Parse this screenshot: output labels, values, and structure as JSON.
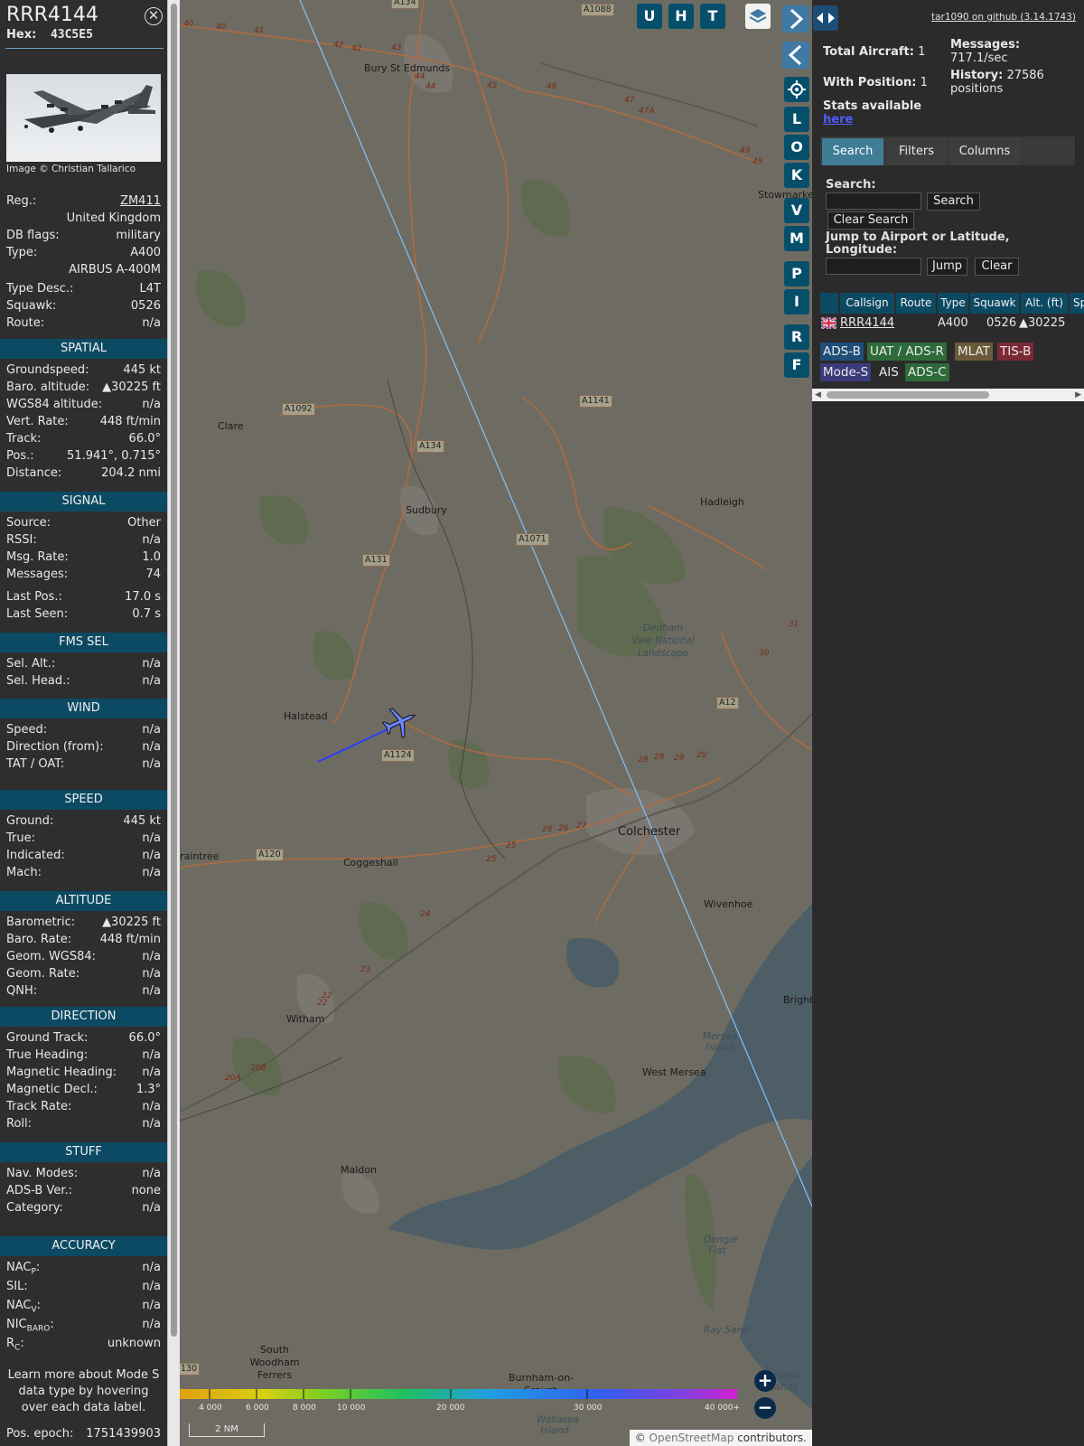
{
  "aircraft": {
    "callsign": "RRR4144",
    "hex_label": "Hex:",
    "hex": "43C5E5",
    "image_credit": "Image © Christian Tallarico",
    "fields": [
      {
        "k": "Reg.:",
        "v": "ZM411",
        "link": true
      },
      {
        "k": "",
        "v": "United Kingdom"
      },
      {
        "k": "DB flags:",
        "v": "military"
      },
      {
        "k": "Type:",
        "v": "A400"
      },
      {
        "k": "",
        "v": "AIRBUS A-400M"
      },
      {
        "k": "Type Desc.:",
        "v": "L4T"
      },
      {
        "k": "Squawk:",
        "v": "0526"
      },
      {
        "k": "Route:",
        "v": "n/a"
      }
    ],
    "sections": [
      {
        "title": "SPATIAL",
        "rows": [
          {
            "k": "Groundspeed:",
            "v": "445 kt"
          },
          {
            "k": "Baro. altitude:",
            "v": "▲30225 ft"
          },
          {
            "k": "WGS84 altitude:",
            "v": "n/a"
          },
          {
            "k": "Vert. Rate:",
            "v": "448 ft/min"
          },
          {
            "k": "Track:",
            "v": "66.0°"
          },
          {
            "k": "Pos.:",
            "v": "51.941°, 0.715°"
          },
          {
            "k": "Distance:",
            "v": "204.2 nmi"
          }
        ]
      },
      {
        "title": "SIGNAL",
        "rows": [
          {
            "k": "Source:",
            "v": "Other"
          },
          {
            "k": "RSSI:",
            "v": "n/a"
          },
          {
            "k": "Msg. Rate:",
            "v": "1.0"
          },
          {
            "k": "Messages:",
            "v": "74"
          },
          {
            "k": "Last Pos.:",
            "v": "17.0 s"
          },
          {
            "k": "Last Seen:",
            "v": "0.7 s"
          }
        ]
      },
      {
        "title": "FMS SEL",
        "rows": [
          {
            "k": "Sel. Alt.:",
            "v": "n/a"
          },
          {
            "k": "Sel. Head.:",
            "v": "n/a"
          }
        ]
      },
      {
        "title": "WIND",
        "rows": [
          {
            "k": "Speed:",
            "v": "n/a"
          },
          {
            "k": "Direction (from):",
            "v": "n/a"
          },
          {
            "k": "TAT / OAT:",
            "v": "n/a"
          }
        ]
      },
      {
        "title": "SPEED",
        "rows": [
          {
            "k": "Ground:",
            "v": "445 kt"
          },
          {
            "k": "True:",
            "v": "n/a"
          },
          {
            "k": "Indicated:",
            "v": "n/a"
          },
          {
            "k": "Mach:",
            "v": "n/a"
          }
        ]
      },
      {
        "title": "ALTITUDE",
        "rows": [
          {
            "k": "Barometric:",
            "v": "▲30225 ft"
          },
          {
            "k": "Baro. Rate:",
            "v": "448 ft/min"
          },
          {
            "k": "Geom. WGS84:",
            "v": "n/a"
          },
          {
            "k": "Geom. Rate:",
            "v": "n/a"
          },
          {
            "k": "QNH:",
            "v": "n/a"
          }
        ]
      },
      {
        "title": "DIRECTION",
        "rows": [
          {
            "k": "Ground Track:",
            "v": "66.0°"
          },
          {
            "k": "True Heading:",
            "v": "n/a"
          },
          {
            "k": "Magnetic Heading:",
            "v": "n/a"
          },
          {
            "k": "Magnetic Decl.:",
            "v": "1.3°"
          },
          {
            "k": "Track Rate:",
            "v": "n/a"
          },
          {
            "k": "Roll:",
            "v": "n/a"
          }
        ]
      },
      {
        "title": "STUFF",
        "rows": [
          {
            "k": "Nav. Modes:",
            "v": "n/a"
          },
          {
            "k": "ADS-B Ver.:",
            "v": "none"
          },
          {
            "k": "Category:",
            "v": "n/a"
          }
        ]
      },
      {
        "title": "ACCURACY",
        "rows": [
          {
            "k": "NAC",
            "sub": "P",
            "v": "n/a"
          },
          {
            "k": "SIL:",
            "v": "n/a"
          },
          {
            "k": "NAC",
            "sub": "V",
            "v": "n/a"
          },
          {
            "k": "NIC",
            "sub": "BARO",
            "v": "n/a"
          },
          {
            "k": "R",
            "sub": "C",
            "v": "unknown"
          }
        ]
      }
    ],
    "note": "Learn more about Mode S data type by hovering over each data label.",
    "pos_epoch_label": "Pos. epoch:",
    "pos_epoch": "1751439903"
  },
  "map": {
    "buttons": [
      "U",
      "H",
      "T",
      "L",
      "O",
      "K",
      "V",
      "M",
      "P",
      "I",
      "R",
      "F"
    ],
    "places": {
      "bury": "Bury St Edmunds",
      "stowmarket": "Stowmarket",
      "clare": "Clare",
      "sudbury": "Sudbury",
      "hadleigh": "Hadleigh",
      "dedham": "Dedham Vale National Landscape",
      "halstead": "Halstead",
      "colchester": "Colchester",
      "braintree": "raintree",
      "coggeshall": "Coggeshall",
      "wivenhoe": "Wivenhoe",
      "witham": "Witham",
      "mersea_island": "Mersea Island",
      "west_mersea": "West Mersea",
      "maldon": "Maldon",
      "dengie": "Dengie Flat",
      "ray_sand": "Ray Sand",
      "south_woodham": "South Woodham Ferrers",
      "burnham": "Burnham-on-Crouch",
      "wallasea": "Wallasea Island",
      "bright": "Bright",
      "sands": "alness Sands"
    },
    "roads": {
      "a134_top": "A134",
      "a1088": "A1088",
      "a1092": "A1092",
      "a134": "A134",
      "a1141": "A1141",
      "a1071": "A1071",
      "a131": "A131",
      "a12": "A12",
      "a1124": "A1124",
      "a120": "A120",
      "a130": "130"
    },
    "junctions": [
      "40",
      "40",
      "41",
      "42",
      "42",
      "43",
      "44",
      "44",
      "45",
      "46",
      "47",
      "47A",
      "49",
      "49",
      "31",
      "30",
      "28",
      "28",
      "29",
      "29",
      "26",
      "26",
      "27",
      "25",
      "25",
      "24",
      "23",
      "22",
      "22",
      "20A",
      "20B"
    ],
    "altitude_legend": [
      "4 000",
      "6 000",
      "8 000",
      "10 000",
      "20 000",
      "30 000",
      "40 000+"
    ],
    "scale": "2 NM",
    "attribution_prefix": "©",
    "attribution_link": "OpenStreetMap",
    "attribution_suffix": "contributors.",
    "zoom_in": "+",
    "zoom_out": "−"
  },
  "panel": {
    "github": "tar1090 on github (3.14.1743)",
    "total_aircraft_label": "Total Aircraft:",
    "total_aircraft": "1",
    "with_position_label": "With Position:",
    "with_position": "1",
    "messages_label": "Messages:",
    "messages": "717.1/sec",
    "history_label": "History:",
    "history": "27586 positions",
    "stats_label": "Stats available",
    "stats_link": "here",
    "tabs": [
      "Search",
      "Filters",
      "Columns"
    ],
    "search_label": "Search:",
    "search_button": "Search",
    "clear_search_button": "Clear Search",
    "jump_label": "Jump to Airport or Latitude, Longitude:",
    "jump_button": "Jump",
    "clear_button": "Clear",
    "table_headers": [
      "",
      "Callsign",
      "Route",
      "Type",
      "Squawk",
      "Alt. (ft)",
      "Sp"
    ],
    "table_row": {
      "callsign": "RRR4144",
      "route": "",
      "type": "A400",
      "squawk": "0526",
      "alt": "▲30225"
    },
    "sources": [
      {
        "label": "ADS-B",
        "color": "#1f4e79"
      },
      {
        "label": "UAT / ADS-R",
        "color": "#2d6b3a"
      },
      {
        "label": "MLAT",
        "color": "#6b5a3a"
      },
      {
        "label": "TIS-B",
        "color": "#7a2a35"
      },
      {
        "label": "Mode-S",
        "color": "#3b3a7a"
      },
      {
        "label": "AIS",
        "color": "#2b2b2b"
      },
      {
        "label": "ADS-C",
        "color": "#2d6b3a"
      }
    ]
  }
}
